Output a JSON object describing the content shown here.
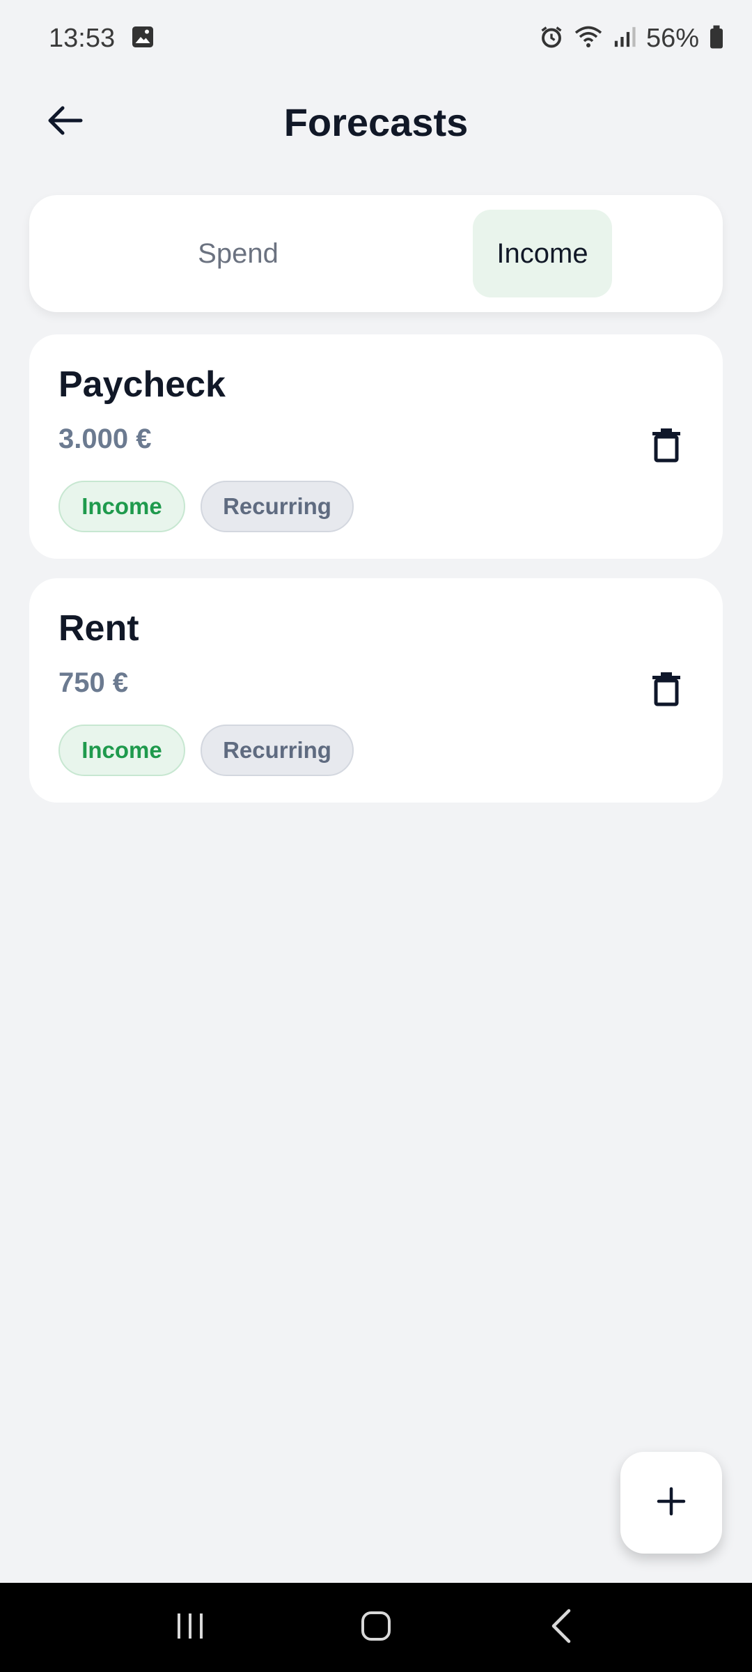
{
  "status_bar": {
    "time": "13:53",
    "battery": "56%",
    "icons": [
      "image-icon",
      "alarm-icon",
      "wifi-icon",
      "signal-icon",
      "battery-icon"
    ]
  },
  "header": {
    "title": "Forecasts",
    "back_icon": "arrow-left-icon"
  },
  "segments": {
    "spend_label": "Spend",
    "income_label": "Income",
    "selected": "Income"
  },
  "forecasts": [
    {
      "name": "Paycheck",
      "amount": "3.000 €",
      "type_tag": "Income",
      "frequency_tag": "Recurring"
    },
    {
      "name": "Rent",
      "amount": "750 €",
      "type_tag": "Income",
      "frequency_tag": "Recurring"
    }
  ],
  "fab": {
    "icon": "plus-icon"
  },
  "nav_bar": {
    "icons": [
      "recent-apps-icon",
      "home-icon",
      "back-icon"
    ]
  },
  "colors": {
    "background": "#f2f3f5",
    "card": "#ffffff",
    "selected_segment": "#e9f4ec",
    "income_green": "#1f9a4d",
    "muted_text": "#6b7a90"
  }
}
